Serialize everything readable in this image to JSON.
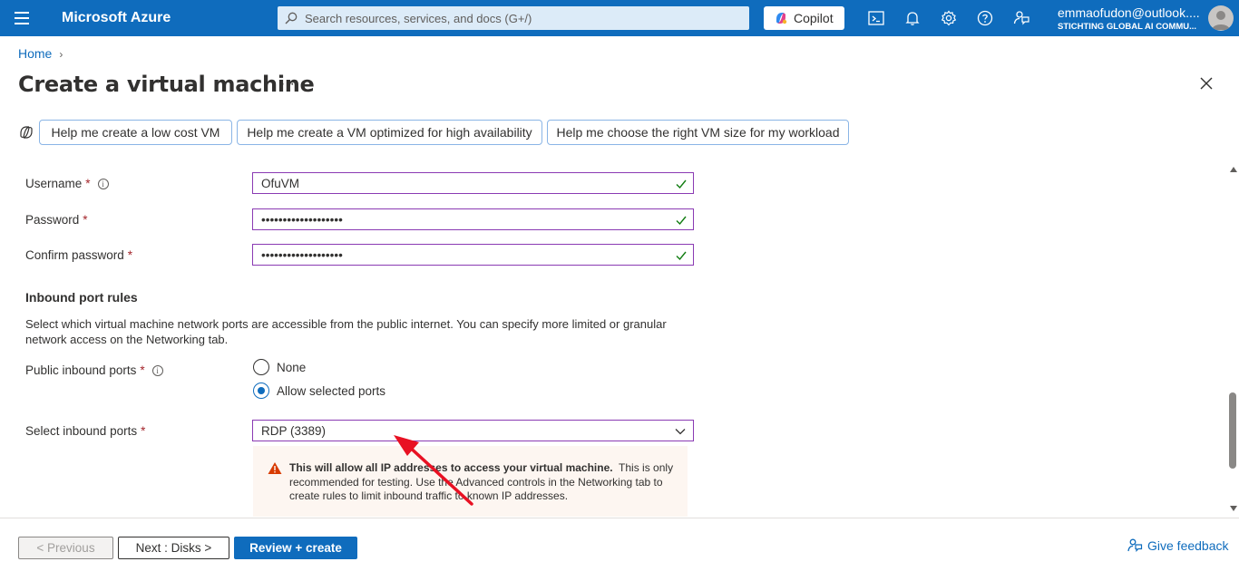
{
  "topbar": {
    "brand": "Microsoft Azure",
    "search_placeholder": "Search resources, services, and docs (G+/)",
    "copilot_label": "Copilot",
    "icons": [
      "terminal-icon",
      "bell-icon",
      "gear-icon",
      "help-icon",
      "feedback-icon"
    ],
    "user_email": "emmaofudon@outlook....",
    "user_org": "STICHTING GLOBAL AI COMMU...",
    "bar_color": "#0f6cbd"
  },
  "header": {
    "breadcrumb_home": "Home",
    "title": "Create a virtual machine",
    "more_label": "···"
  },
  "prompts": [
    "Help me create a low cost VM",
    "Help me create a VM optimized for high availability",
    "Help me choose the right VM size for my workload"
  ],
  "form": {
    "username": {
      "label": "Username",
      "value": "OfuVM"
    },
    "password": {
      "label": "Password",
      "value": "•••••••••••••••••••"
    },
    "confirm_password": {
      "label": "Confirm password",
      "value": "•••••••••••••••••••"
    },
    "required_mark": "*",
    "inbound": {
      "title": "Inbound port rules",
      "description": "Select which virtual machine network ports are accessible from the public internet. You can specify more limited or granular network access on the Networking tab.",
      "public_ports_label": "Public inbound ports",
      "options": [
        "None",
        "Allow selected ports"
      ],
      "selected_option": "Allow selected ports",
      "select_ports_label": "Select inbound ports",
      "select_ports_value": "RDP (3389)",
      "warning_bold": "This will allow all IP addresses to access your virtual machine.",
      "warning_text": "This is only recommended for testing.  Use the Advanced controls in the Networking tab to create rules to limit inbound traffic to known IP addresses."
    }
  },
  "footer": {
    "previous": "< Previous",
    "next": "Next : Disks >",
    "review": "Review + create",
    "feedback": "Give feedback"
  },
  "colors": {
    "accent": "#0f6cbd",
    "field_border": "#8a3ab3",
    "valid_check": "#107c10",
    "required": "#a4262c",
    "warning_bg": "#fdf6f1",
    "warning_icon": "#d83b01",
    "annotation_arrow": "#e81123"
  }
}
